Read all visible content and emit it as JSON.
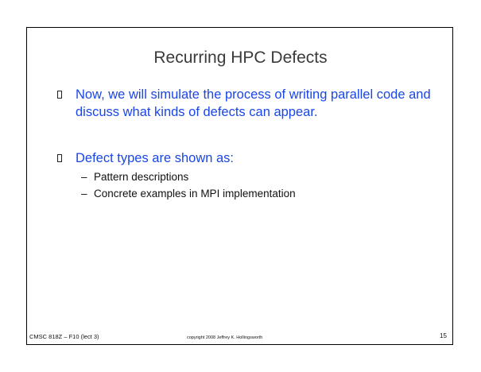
{
  "slide": {
    "title": "Recurring HPC Defects",
    "bullets": [
      {
        "text": "Now, we will simulate the process of writing parallel code and discuss what kinds of defects can appear."
      },
      {
        "text": "Defect types are shown as:",
        "sub_items": [
          {
            "dash": "–",
            "text": "Pattern descriptions"
          },
          {
            "dash": "–",
            "text": "Concrete examples in MPI implementation"
          }
        ]
      }
    ],
    "footer": {
      "left": "CMSC 818Z – F10 (lect 3)",
      "center": "copyright 2008 Jeffrey K. Hollingsworth",
      "page_number": "15"
    }
  },
  "colors": {
    "title": "#3b3b3b",
    "bullet_text": "#1a46e8",
    "sub_text": "#111111",
    "frame": "#000000"
  },
  "icons": {
    "bullet_marker": "hollow-rectangle"
  }
}
